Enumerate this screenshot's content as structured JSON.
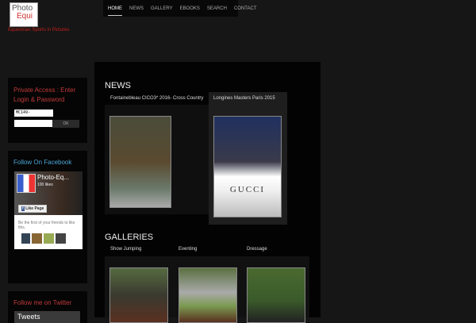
{
  "logo": {
    "line1": "Photo",
    "line2": "Equi",
    "tagline": "Equestrian Sports in Pictures"
  },
  "nav": [
    "HOME",
    "NEWS",
    "GALLERY",
    "EBOOKS",
    "SEARCH",
    "CONTACT"
  ],
  "private": {
    "title": "Private Access : Enter Login & Password",
    "login_value": "MC149-",
    "password_value": "",
    "ok": "OK"
  },
  "facebook": {
    "title": "Follow On Facebook",
    "page": "Photo-Eq...",
    "likes": "100 likes",
    "like_btn": "Like Page",
    "friends": "Be the first of your friends to like this."
  },
  "twitter": {
    "title": "Follow me on Twitter",
    "tweets": "Tweets"
  },
  "news": {
    "title": "NEWS",
    "items": [
      "Fontainebleau CICO3* 2016- Cross Country",
      "Longines Masters Paris 2015"
    ],
    "gucci": "GUCCI"
  },
  "galleries": {
    "title": "GALLERIES",
    "items": [
      "Show Jumping",
      "Eventing",
      "Dressage"
    ]
  },
  "colors": {
    "accent_red": "#c23a3a",
    "accent_blue": "#4aa6d6"
  }
}
